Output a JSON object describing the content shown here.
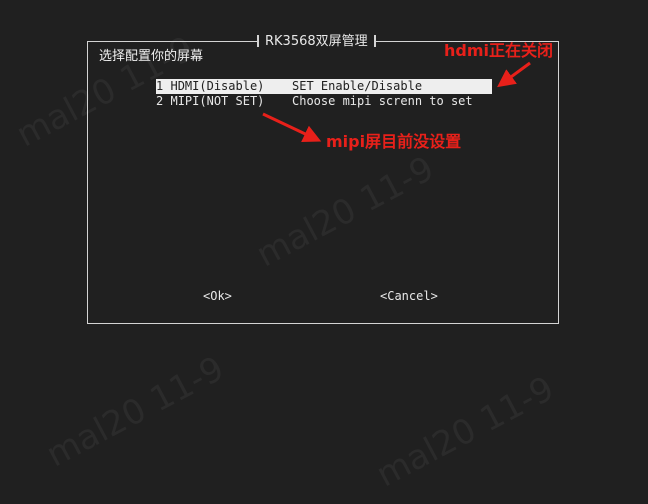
{
  "dialog": {
    "title": "RK3568双屏管理",
    "prompt": "选择配置你的屏幕"
  },
  "menu": {
    "items": [
      {
        "tag": "HDMI(Disable)",
        "description": "SET Enable/Disable",
        "hotkey": "1",
        "selected": true
      },
      {
        "tag": "MIPI(NOT SET)",
        "description": "Choose mipi screnn to set",
        "hotkey": "2",
        "selected": false
      }
    ]
  },
  "buttons": {
    "ok_label": "<Ok>",
    "cancel_label": "<Cancel>"
  },
  "annotations": {
    "hdmi_note": "hdmi正在关闭",
    "mipi_note": "mipi屏目前没设置",
    "color": "#e8201a"
  },
  "watermark": {
    "text": "mal20 11-9"
  }
}
